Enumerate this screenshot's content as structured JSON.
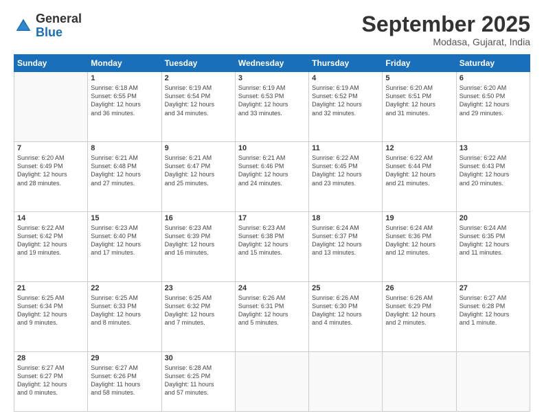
{
  "logo": {
    "general": "General",
    "blue": "Blue"
  },
  "header": {
    "month": "September 2025",
    "location": "Modasa, Gujarat, India"
  },
  "days_of_week": [
    "Sunday",
    "Monday",
    "Tuesday",
    "Wednesday",
    "Thursday",
    "Friday",
    "Saturday"
  ],
  "weeks": [
    [
      {
        "day": "",
        "info": ""
      },
      {
        "day": "1",
        "info": "Sunrise: 6:18 AM\nSunset: 6:55 PM\nDaylight: 12 hours\nand 36 minutes."
      },
      {
        "day": "2",
        "info": "Sunrise: 6:19 AM\nSunset: 6:54 PM\nDaylight: 12 hours\nand 34 minutes."
      },
      {
        "day": "3",
        "info": "Sunrise: 6:19 AM\nSunset: 6:53 PM\nDaylight: 12 hours\nand 33 minutes."
      },
      {
        "day": "4",
        "info": "Sunrise: 6:19 AM\nSunset: 6:52 PM\nDaylight: 12 hours\nand 32 minutes."
      },
      {
        "day": "5",
        "info": "Sunrise: 6:20 AM\nSunset: 6:51 PM\nDaylight: 12 hours\nand 31 minutes."
      },
      {
        "day": "6",
        "info": "Sunrise: 6:20 AM\nSunset: 6:50 PM\nDaylight: 12 hours\nand 29 minutes."
      }
    ],
    [
      {
        "day": "7",
        "info": "Sunrise: 6:20 AM\nSunset: 6:49 PM\nDaylight: 12 hours\nand 28 minutes."
      },
      {
        "day": "8",
        "info": "Sunrise: 6:21 AM\nSunset: 6:48 PM\nDaylight: 12 hours\nand 27 minutes."
      },
      {
        "day": "9",
        "info": "Sunrise: 6:21 AM\nSunset: 6:47 PM\nDaylight: 12 hours\nand 25 minutes."
      },
      {
        "day": "10",
        "info": "Sunrise: 6:21 AM\nSunset: 6:46 PM\nDaylight: 12 hours\nand 24 minutes."
      },
      {
        "day": "11",
        "info": "Sunrise: 6:22 AM\nSunset: 6:45 PM\nDaylight: 12 hours\nand 23 minutes."
      },
      {
        "day": "12",
        "info": "Sunrise: 6:22 AM\nSunset: 6:44 PM\nDaylight: 12 hours\nand 21 minutes."
      },
      {
        "day": "13",
        "info": "Sunrise: 6:22 AM\nSunset: 6:43 PM\nDaylight: 12 hours\nand 20 minutes."
      }
    ],
    [
      {
        "day": "14",
        "info": "Sunrise: 6:22 AM\nSunset: 6:42 PM\nDaylight: 12 hours\nand 19 minutes."
      },
      {
        "day": "15",
        "info": "Sunrise: 6:23 AM\nSunset: 6:40 PM\nDaylight: 12 hours\nand 17 minutes."
      },
      {
        "day": "16",
        "info": "Sunrise: 6:23 AM\nSunset: 6:39 PM\nDaylight: 12 hours\nand 16 minutes."
      },
      {
        "day": "17",
        "info": "Sunrise: 6:23 AM\nSunset: 6:38 PM\nDaylight: 12 hours\nand 15 minutes."
      },
      {
        "day": "18",
        "info": "Sunrise: 6:24 AM\nSunset: 6:37 PM\nDaylight: 12 hours\nand 13 minutes."
      },
      {
        "day": "19",
        "info": "Sunrise: 6:24 AM\nSunset: 6:36 PM\nDaylight: 12 hours\nand 12 minutes."
      },
      {
        "day": "20",
        "info": "Sunrise: 6:24 AM\nSunset: 6:35 PM\nDaylight: 12 hours\nand 11 minutes."
      }
    ],
    [
      {
        "day": "21",
        "info": "Sunrise: 6:25 AM\nSunset: 6:34 PM\nDaylight: 12 hours\nand 9 minutes."
      },
      {
        "day": "22",
        "info": "Sunrise: 6:25 AM\nSunset: 6:33 PM\nDaylight: 12 hours\nand 8 minutes."
      },
      {
        "day": "23",
        "info": "Sunrise: 6:25 AM\nSunset: 6:32 PM\nDaylight: 12 hours\nand 7 minutes."
      },
      {
        "day": "24",
        "info": "Sunrise: 6:26 AM\nSunset: 6:31 PM\nDaylight: 12 hours\nand 5 minutes."
      },
      {
        "day": "25",
        "info": "Sunrise: 6:26 AM\nSunset: 6:30 PM\nDaylight: 12 hours\nand 4 minutes."
      },
      {
        "day": "26",
        "info": "Sunrise: 6:26 AM\nSunset: 6:29 PM\nDaylight: 12 hours\nand 2 minutes."
      },
      {
        "day": "27",
        "info": "Sunrise: 6:27 AM\nSunset: 6:28 PM\nDaylight: 12 hours\nand 1 minute."
      }
    ],
    [
      {
        "day": "28",
        "info": "Sunrise: 6:27 AM\nSunset: 6:27 PM\nDaylight: 12 hours\nand 0 minutes."
      },
      {
        "day": "29",
        "info": "Sunrise: 6:27 AM\nSunset: 6:26 PM\nDaylight: 11 hours\nand 58 minutes."
      },
      {
        "day": "30",
        "info": "Sunrise: 6:28 AM\nSunset: 6:25 PM\nDaylight: 11 hours\nand 57 minutes."
      },
      {
        "day": "",
        "info": ""
      },
      {
        "day": "",
        "info": ""
      },
      {
        "day": "",
        "info": ""
      },
      {
        "day": "",
        "info": ""
      }
    ]
  ]
}
